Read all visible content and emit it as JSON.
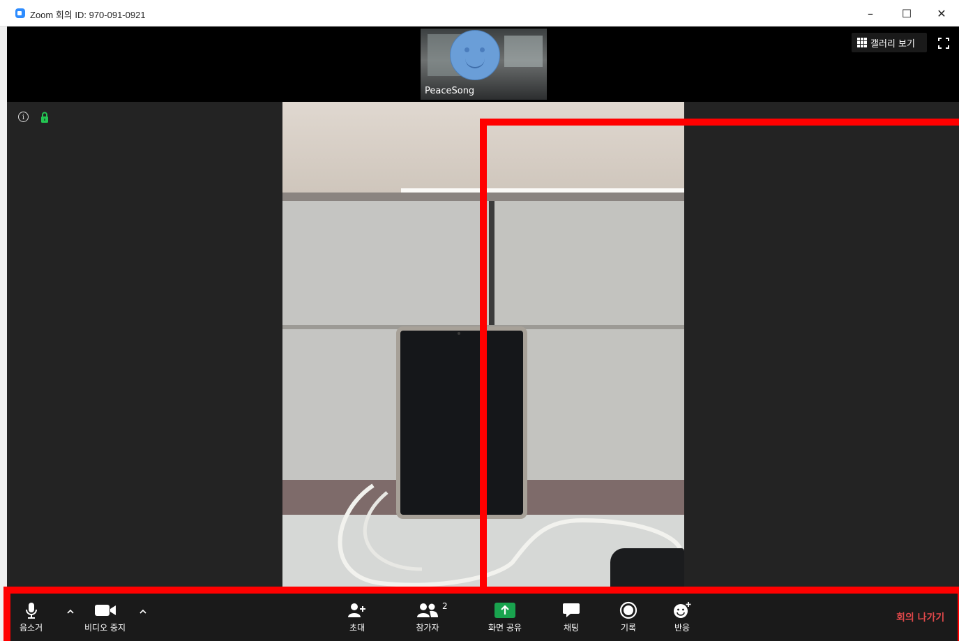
{
  "window": {
    "title": "Zoom 회의 ID: 970-091-0921",
    "minimize_glyph": "–",
    "maximize_glyph": "☐",
    "close_glyph": "✕"
  },
  "top_strip": {
    "participant_name": "PeaceSong",
    "gallery_view_label": "갤러리 보기",
    "icons": [
      "gallery-icon",
      "fullscreen-icon"
    ]
  },
  "meeting_info": {
    "info_icon_glyph": "i",
    "icons": [
      "info-icon",
      "lock-icon"
    ]
  },
  "toolbar": {
    "mute_label": "음소거",
    "video_label": "비디오 중지",
    "invite_label": "초대",
    "participants_label": "참가자",
    "participants_count": "2",
    "share_label": "화면 공유",
    "chat_label": "채팅",
    "record_label": "기록",
    "reactions_label": "반응",
    "leave_label": "회의 나가기"
  },
  "colors": {
    "annotation_red": "#ff0000",
    "leave_red": "#e0484a",
    "share_green": "#19a34e",
    "toolbar_bg": "#1a1a1a",
    "meeting_bg": "#232323"
  }
}
